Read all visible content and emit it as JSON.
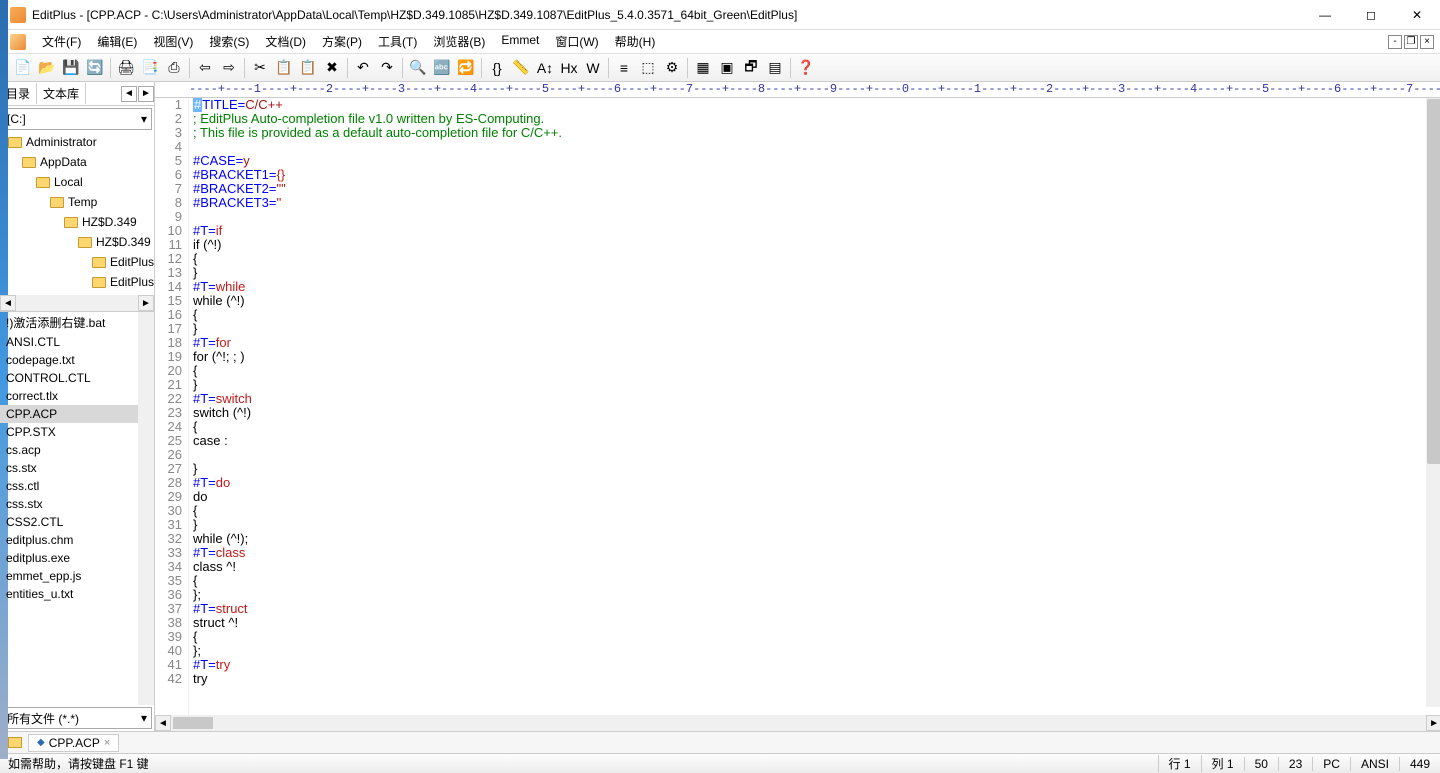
{
  "title": "EditPlus - [CPP.ACP - C:\\Users\\Administrator\\AppData\\Local\\Temp\\HZ$D.349.1085\\HZ$D.349.1087\\EditPlus_5.4.0.3571_64bit_Green\\EditPlus]",
  "menus": [
    "文件(F)",
    "编辑(E)",
    "视图(V)",
    "搜索(S)",
    "文档(D)",
    "方案(P)",
    "工具(T)",
    "浏览器(B)",
    "Emmet",
    "窗口(W)",
    "帮助(H)"
  ],
  "sidebar": {
    "tab1": "目录",
    "tab2": "文本库",
    "drive": "[C:]",
    "tree": [
      {
        "indent": 0,
        "label": "Administrator"
      },
      {
        "indent": 1,
        "label": "AppData"
      },
      {
        "indent": 2,
        "label": "Local"
      },
      {
        "indent": 3,
        "label": "Temp"
      },
      {
        "indent": 4,
        "label": "HZ$D.349"
      },
      {
        "indent": 5,
        "label": "HZ$D.349"
      },
      {
        "indent": 6,
        "label": "EditPlus"
      },
      {
        "indent": 6,
        "label": "EditPlus"
      }
    ],
    "files": [
      "!)激活添删右键.bat",
      "ANSI.CTL",
      "codepage.txt",
      "CONTROL.CTL",
      "correct.tlx",
      "CPP.ACP",
      "CPP.STX",
      "cs.acp",
      "cs.stx",
      "css.ctl",
      "css.stx",
      "CSS2.CTL",
      "editplus.chm",
      "editplus.exe",
      "emmet_epp.js",
      "entities_u.txt"
    ],
    "selected_file": "CPP.ACP",
    "filter": "所有文件 (*.*)"
  },
  "ruler": "----+----1----+----2----+----3----+----4----+----5----+----6----+----7----+----8----+----9----+----0----+----1----+----2----+----3----+----4----+----5----+----6----+----7----",
  "code": [
    {
      "n": 1,
      "segs": [
        {
          "t": "#",
          "c": "cursor-block"
        },
        {
          "t": "TITLE=",
          "c": "kw-title"
        },
        {
          "t": "C/C++",
          "c": "kw-val"
        }
      ]
    },
    {
      "n": 2,
      "segs": [
        {
          "t": "; EditPlus Auto-completion file v1.0 written by ES-Computing.",
          "c": "cm"
        }
      ]
    },
    {
      "n": 3,
      "segs": [
        {
          "t": "; This file is provided as a default auto-completion file for C/C++.",
          "c": "cm"
        }
      ]
    },
    {
      "n": 4,
      "segs": []
    },
    {
      "n": 5,
      "segs": [
        {
          "t": "#CASE=",
          "c": "kw-title"
        },
        {
          "t": "y",
          "c": "kw-val"
        }
      ]
    },
    {
      "n": 6,
      "segs": [
        {
          "t": "#BRACKET1=",
          "c": "kw-title"
        },
        {
          "t": "{}",
          "c": "sym"
        }
      ]
    },
    {
      "n": 7,
      "segs": [
        {
          "t": "#BRACKET2=",
          "c": "kw-title"
        },
        {
          "t": "\"\"",
          "c": "kw-val"
        }
      ]
    },
    {
      "n": 8,
      "segs": [
        {
          "t": "#BRACKET3=",
          "c": "kw-title"
        },
        {
          "t": "''",
          "c": "kw-val"
        }
      ]
    },
    {
      "n": 9,
      "segs": []
    },
    {
      "n": 10,
      "segs": [
        {
          "t": "#T=",
          "c": "kw-dir"
        },
        {
          "t": "if",
          "c": "kw-key"
        }
      ]
    },
    {
      "n": 11,
      "segs": [
        {
          "t": "if (^!)",
          "c": ""
        }
      ]
    },
    {
      "n": 12,
      "segs": [
        {
          "t": "{",
          "c": ""
        }
      ]
    },
    {
      "n": 13,
      "segs": [
        {
          "t": "}",
          "c": ""
        }
      ]
    },
    {
      "n": 14,
      "segs": [
        {
          "t": "#T=",
          "c": "kw-dir"
        },
        {
          "t": "while",
          "c": "kw-key"
        }
      ]
    },
    {
      "n": 15,
      "segs": [
        {
          "t": "while (^!)",
          "c": ""
        }
      ]
    },
    {
      "n": 16,
      "segs": [
        {
          "t": "{",
          "c": ""
        }
      ]
    },
    {
      "n": 17,
      "segs": [
        {
          "t": "}",
          "c": ""
        }
      ]
    },
    {
      "n": 18,
      "segs": [
        {
          "t": "#T=",
          "c": "kw-dir"
        },
        {
          "t": "for",
          "c": "kw-key"
        }
      ]
    },
    {
      "n": 19,
      "segs": [
        {
          "t": "for (^!; ; )",
          "c": ""
        }
      ]
    },
    {
      "n": 20,
      "segs": [
        {
          "t": "{",
          "c": ""
        }
      ]
    },
    {
      "n": 21,
      "segs": [
        {
          "t": "}",
          "c": ""
        }
      ]
    },
    {
      "n": 22,
      "segs": [
        {
          "t": "#T=",
          "c": "kw-dir"
        },
        {
          "t": "switch",
          "c": "kw-key"
        }
      ]
    },
    {
      "n": 23,
      "segs": [
        {
          "t": "switch (^!)",
          "c": ""
        }
      ]
    },
    {
      "n": 24,
      "segs": [
        {
          "t": "{",
          "c": ""
        }
      ]
    },
    {
      "n": 25,
      "segs": [
        {
          "t": "case :",
          "c": ""
        }
      ]
    },
    {
      "n": 26,
      "segs": []
    },
    {
      "n": 27,
      "segs": [
        {
          "t": "}",
          "c": ""
        }
      ]
    },
    {
      "n": 28,
      "segs": [
        {
          "t": "#T=",
          "c": "kw-dir"
        },
        {
          "t": "do",
          "c": "kw-key"
        }
      ]
    },
    {
      "n": 29,
      "segs": [
        {
          "t": "do",
          "c": ""
        }
      ]
    },
    {
      "n": 30,
      "segs": [
        {
          "t": "{",
          "c": ""
        }
      ]
    },
    {
      "n": 31,
      "segs": [
        {
          "t": "}",
          "c": ""
        }
      ]
    },
    {
      "n": 32,
      "segs": [
        {
          "t": "while (^!);",
          "c": ""
        }
      ]
    },
    {
      "n": 33,
      "segs": [
        {
          "t": "#T=",
          "c": "kw-dir"
        },
        {
          "t": "class",
          "c": "kw-key"
        }
      ]
    },
    {
      "n": 34,
      "segs": [
        {
          "t": "class ^!",
          "c": ""
        }
      ]
    },
    {
      "n": 35,
      "segs": [
        {
          "t": "{",
          "c": ""
        }
      ]
    },
    {
      "n": 36,
      "segs": [
        {
          "t": "};",
          "c": ""
        }
      ]
    },
    {
      "n": 37,
      "segs": [
        {
          "t": "#T=",
          "c": "kw-dir"
        },
        {
          "t": "struct",
          "c": "kw-key"
        }
      ]
    },
    {
      "n": 38,
      "segs": [
        {
          "t": "struct ^!",
          "c": ""
        }
      ]
    },
    {
      "n": 39,
      "segs": [
        {
          "t": "{",
          "c": ""
        }
      ]
    },
    {
      "n": 40,
      "segs": [
        {
          "t": "};",
          "c": ""
        }
      ]
    },
    {
      "n": 41,
      "segs": [
        {
          "t": "#T=",
          "c": "kw-dir"
        },
        {
          "t": "try",
          "c": "kw-key"
        }
      ]
    },
    {
      "n": 42,
      "segs": [
        {
          "t": "try",
          "c": ""
        }
      ]
    }
  ],
  "doc_tab": "CPP.ACP",
  "status": {
    "help": "如需帮助，请按键盘 F1 键",
    "line": "行 1",
    "col": "列 1",
    "v1": "50",
    "v2": "23",
    "mode": "PC",
    "enc": "ANSI",
    "v3": "449"
  },
  "toolbar_icons": [
    "📄",
    "📂",
    "💾",
    "🔄",
    "|",
    "🖨",
    "📑",
    "⎙",
    "|",
    "⇦",
    "⇨",
    "|",
    "✂",
    "📋",
    "📋",
    "✖",
    "|",
    "↶",
    "↷",
    "|",
    "🔍",
    "🔤",
    "🔁",
    "|",
    "{}",
    "📏",
    "A↕",
    "Hx",
    "W",
    "|",
    "≡",
    "⬚",
    "⚙",
    "|",
    "▦",
    "▣",
    "🗗",
    "▤",
    "|",
    "❓"
  ]
}
